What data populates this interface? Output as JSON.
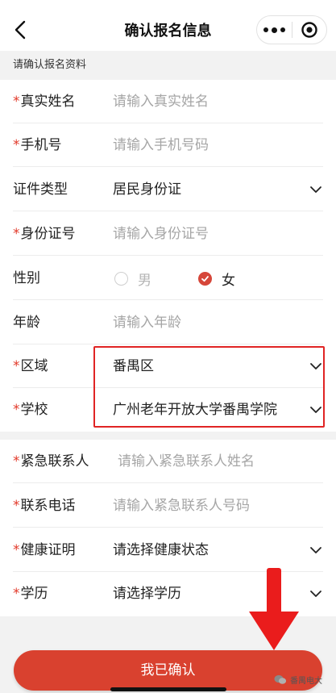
{
  "navbar": {
    "title": "确认报名信息"
  },
  "section": {
    "heading": "请确认报名资料"
  },
  "fields": [
    {
      "label": "真实姓名",
      "required": true,
      "value": "请输入真实姓名",
      "placeholder": true,
      "type": "input"
    },
    {
      "label": "手机号",
      "required": true,
      "value": "请输入手机号码",
      "placeholder": true,
      "type": "input"
    },
    {
      "label": "证件类型",
      "required": false,
      "value": "居民身份证",
      "placeholder": false,
      "type": "select"
    },
    {
      "label": "身份证号",
      "required": true,
      "value": "请输入身份证号",
      "placeholder": true,
      "type": "input"
    },
    {
      "label": "性别",
      "required": false,
      "type": "radio",
      "options": [
        "男",
        "女"
      ],
      "selected": "女"
    },
    {
      "label": "年龄",
      "required": false,
      "value": "请输入年龄",
      "placeholder": true,
      "type": "input"
    },
    {
      "label": "区域",
      "required": true,
      "value": "番禺区",
      "placeholder": false,
      "type": "select"
    },
    {
      "label": "学校",
      "required": true,
      "value": "广州老年开放大学番禺学院",
      "placeholder": false,
      "type": "select"
    },
    {
      "label": "紧急联系人",
      "required": true,
      "value": "请输入紧急联系人姓名",
      "placeholder": true,
      "type": "input"
    },
    {
      "label": "联系电话",
      "required": true,
      "value": "请输入紧急联系人号码",
      "placeholder": true,
      "type": "input"
    },
    {
      "label": "健康证明",
      "required": true,
      "value": "请选择健康状态",
      "placeholder": false,
      "type": "select"
    },
    {
      "label": "学历",
      "required": true,
      "value": "请选择学历",
      "placeholder": false,
      "type": "select"
    }
  ],
  "required_mark": "*",
  "confirm_button": {
    "label": "我已确认"
  },
  "watermark": {
    "text": "番禺电大"
  },
  "colors": {
    "accent": "#d9412f",
    "required_star": "#e2392a",
    "highlight_border": "#e02424",
    "placeholder": "#a6a6a6",
    "section_bg": "#f2f2f2"
  },
  "icons": {
    "back": "chevron-left-icon",
    "more": "more-dots-icon",
    "close": "target-circle-icon",
    "dropdown": "chevron-down-icon",
    "check": "check-icon",
    "annotation_arrow": "arrow-down-icon"
  }
}
